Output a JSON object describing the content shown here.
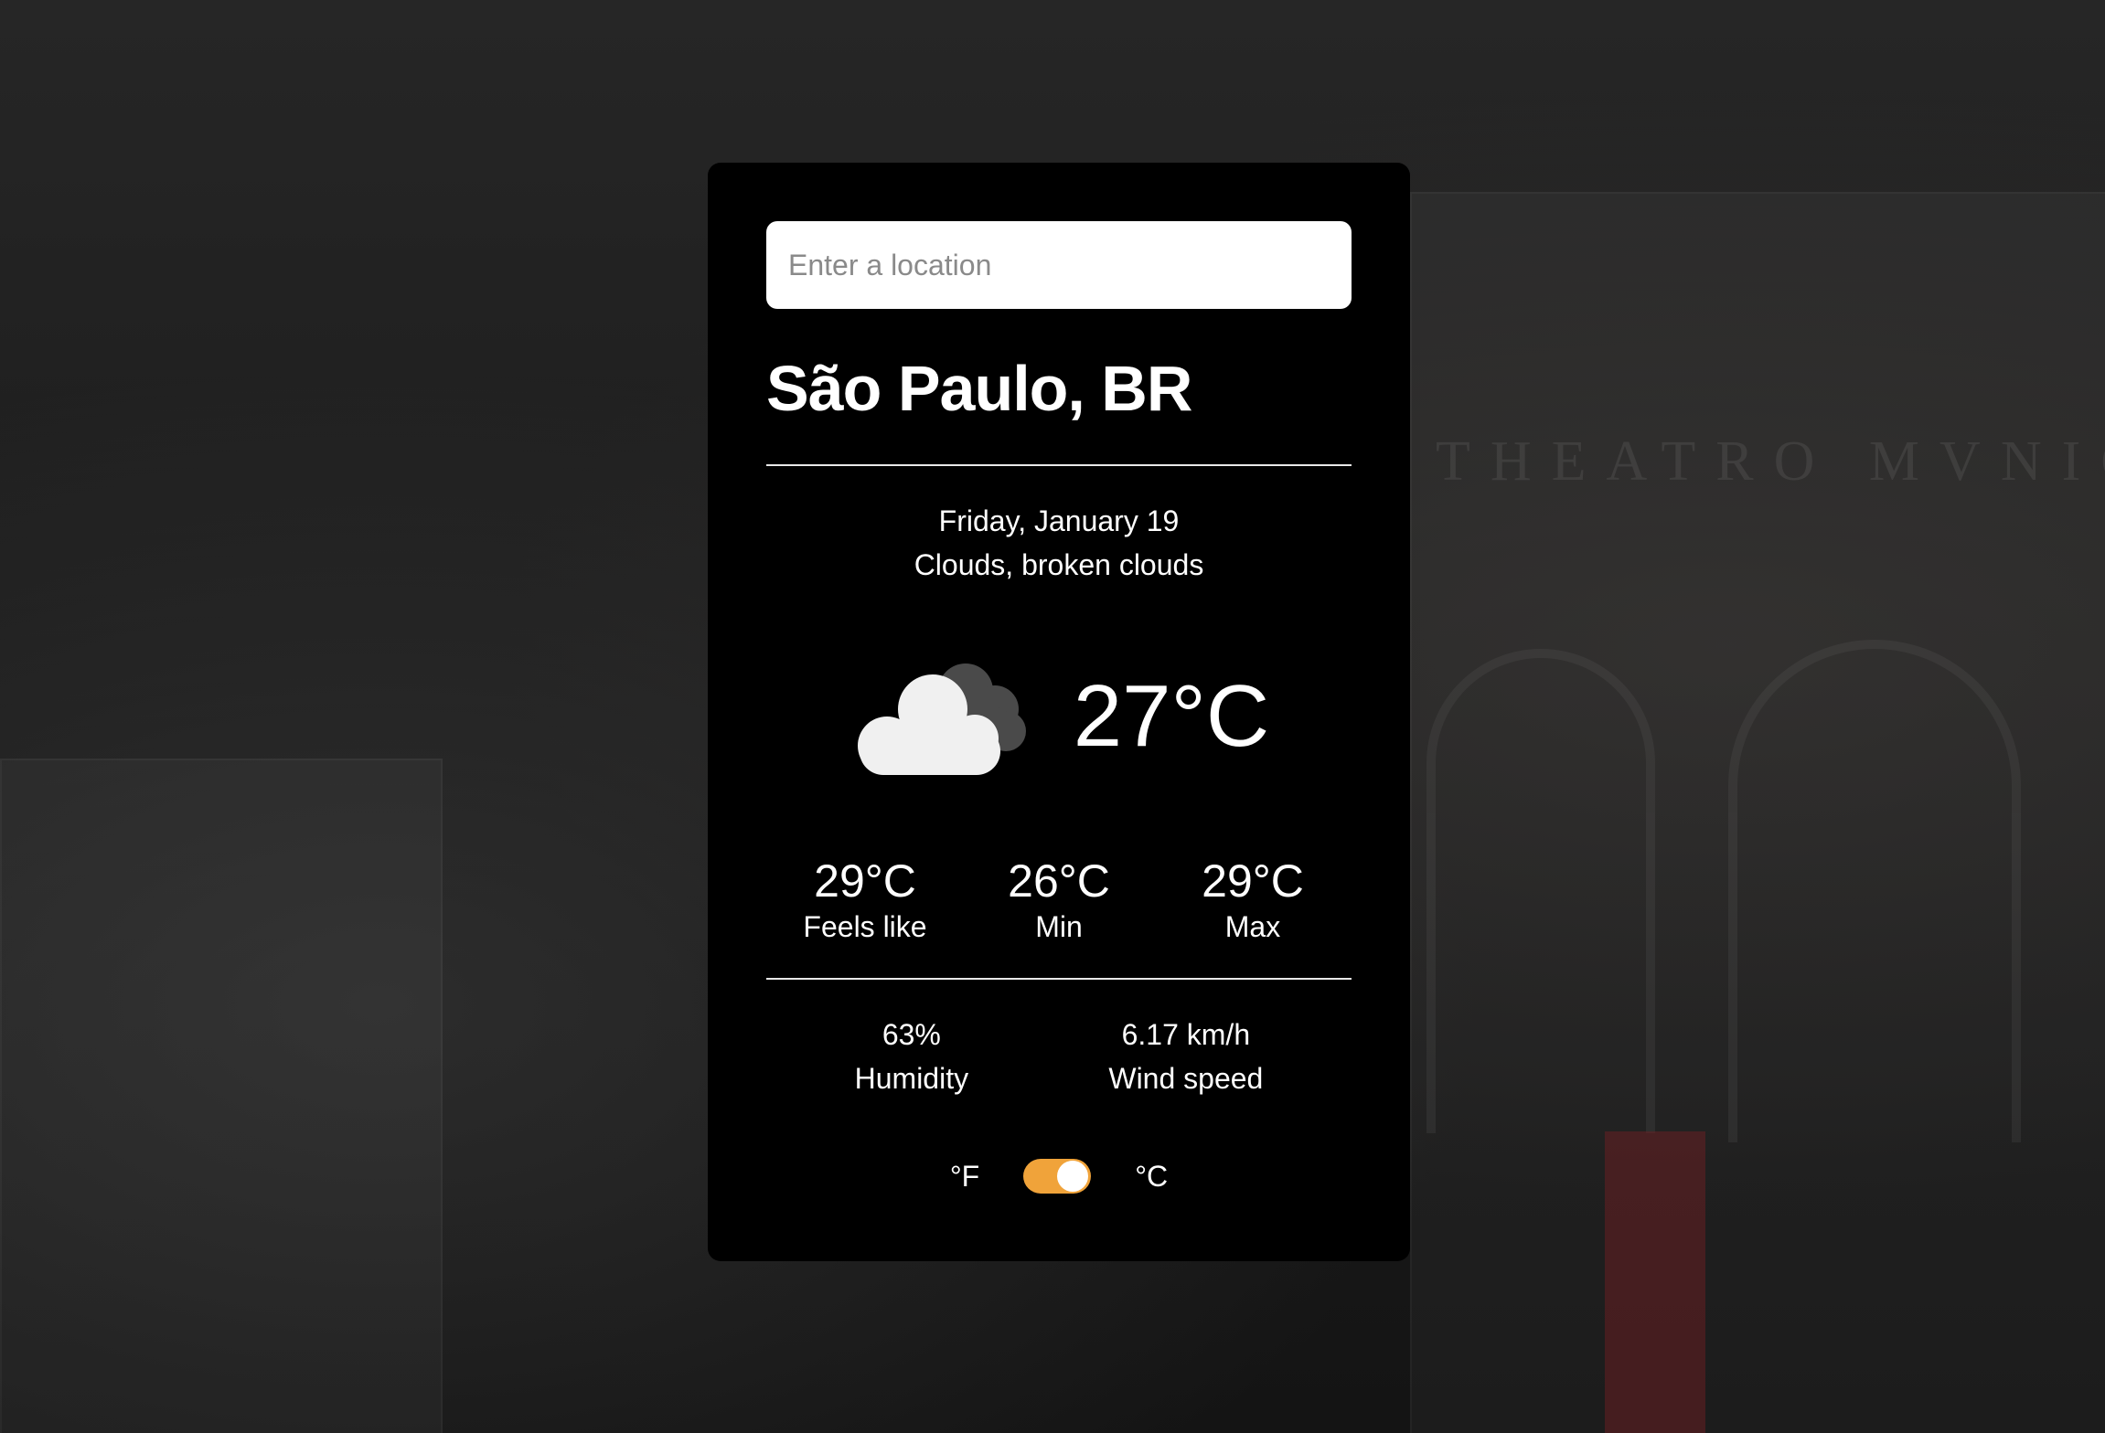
{
  "search": {
    "placeholder": "Enter a location",
    "value": ""
  },
  "location": {
    "name": "São Paulo, BR"
  },
  "summary": {
    "date": "Friday, January 19",
    "condition": "Clouds, broken clouds",
    "icon": "broken-clouds-icon"
  },
  "current": {
    "temperature": "27°C"
  },
  "details": {
    "feels_like": {
      "value": "29°C",
      "label": "Feels like"
    },
    "min": {
      "value": "26°C",
      "label": "Min"
    },
    "max": {
      "value": "29°C",
      "label": "Max"
    }
  },
  "extra": {
    "humidity": {
      "value": "63%",
      "label": "Humidity"
    },
    "wind": {
      "value": "6.17 km/h",
      "label": "Wind speed"
    }
  },
  "units": {
    "fahrenheit_label": "°F",
    "celsius_label": "°C",
    "selected": "celsius",
    "toggle_color": "#f0a33a"
  }
}
